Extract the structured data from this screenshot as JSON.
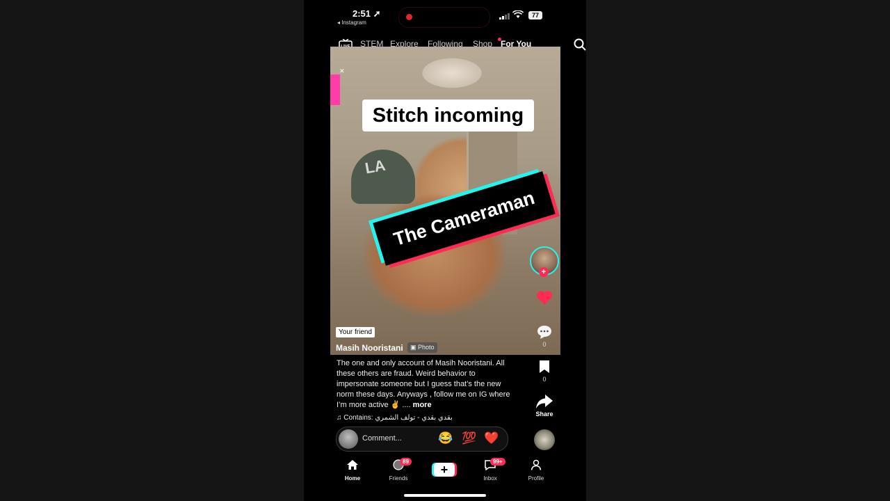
{
  "status_bar": {
    "time": "2:51",
    "back_app": "◂ Instagram",
    "battery": "77"
  },
  "top_nav": {
    "tabs": [
      "STEM",
      "Explore",
      "Following",
      "Shop",
      "For You"
    ],
    "active": "For You"
  },
  "video": {
    "overlay_text_top": "Stitch incoming",
    "overlay_text_banner": "The Cameraman",
    "friend_tag": "Your friend",
    "username": "Masih Nooristani",
    "media_type": "Photo"
  },
  "rail": {
    "comments": "0",
    "bookmarks": "0",
    "share_label": "Share"
  },
  "caption": {
    "text": "The one and only account of Masih Nooristani. All these others are fraud. Weird behavior to impersonate someone but I guess that’s the new norm these days.  Anyways , follow me on IG where I’m more active ✌️ ....",
    "more": "more"
  },
  "sound": {
    "text": "Contains: بقدي بقدي - تولف الشمري"
  },
  "comment_bar": {
    "placeholder": "Comment...",
    "emojis": [
      "😂",
      "💯",
      "❤️"
    ]
  },
  "bottom_nav": {
    "items": [
      {
        "label": "Home"
      },
      {
        "label": "Friends",
        "badge": "89"
      },
      {
        "label": ""
      },
      {
        "label": "Inbox",
        "badge": "99+"
      },
      {
        "label": "Profile"
      }
    ]
  },
  "colors": {
    "cyan": "#25f4ee",
    "red": "#fe2c55"
  }
}
